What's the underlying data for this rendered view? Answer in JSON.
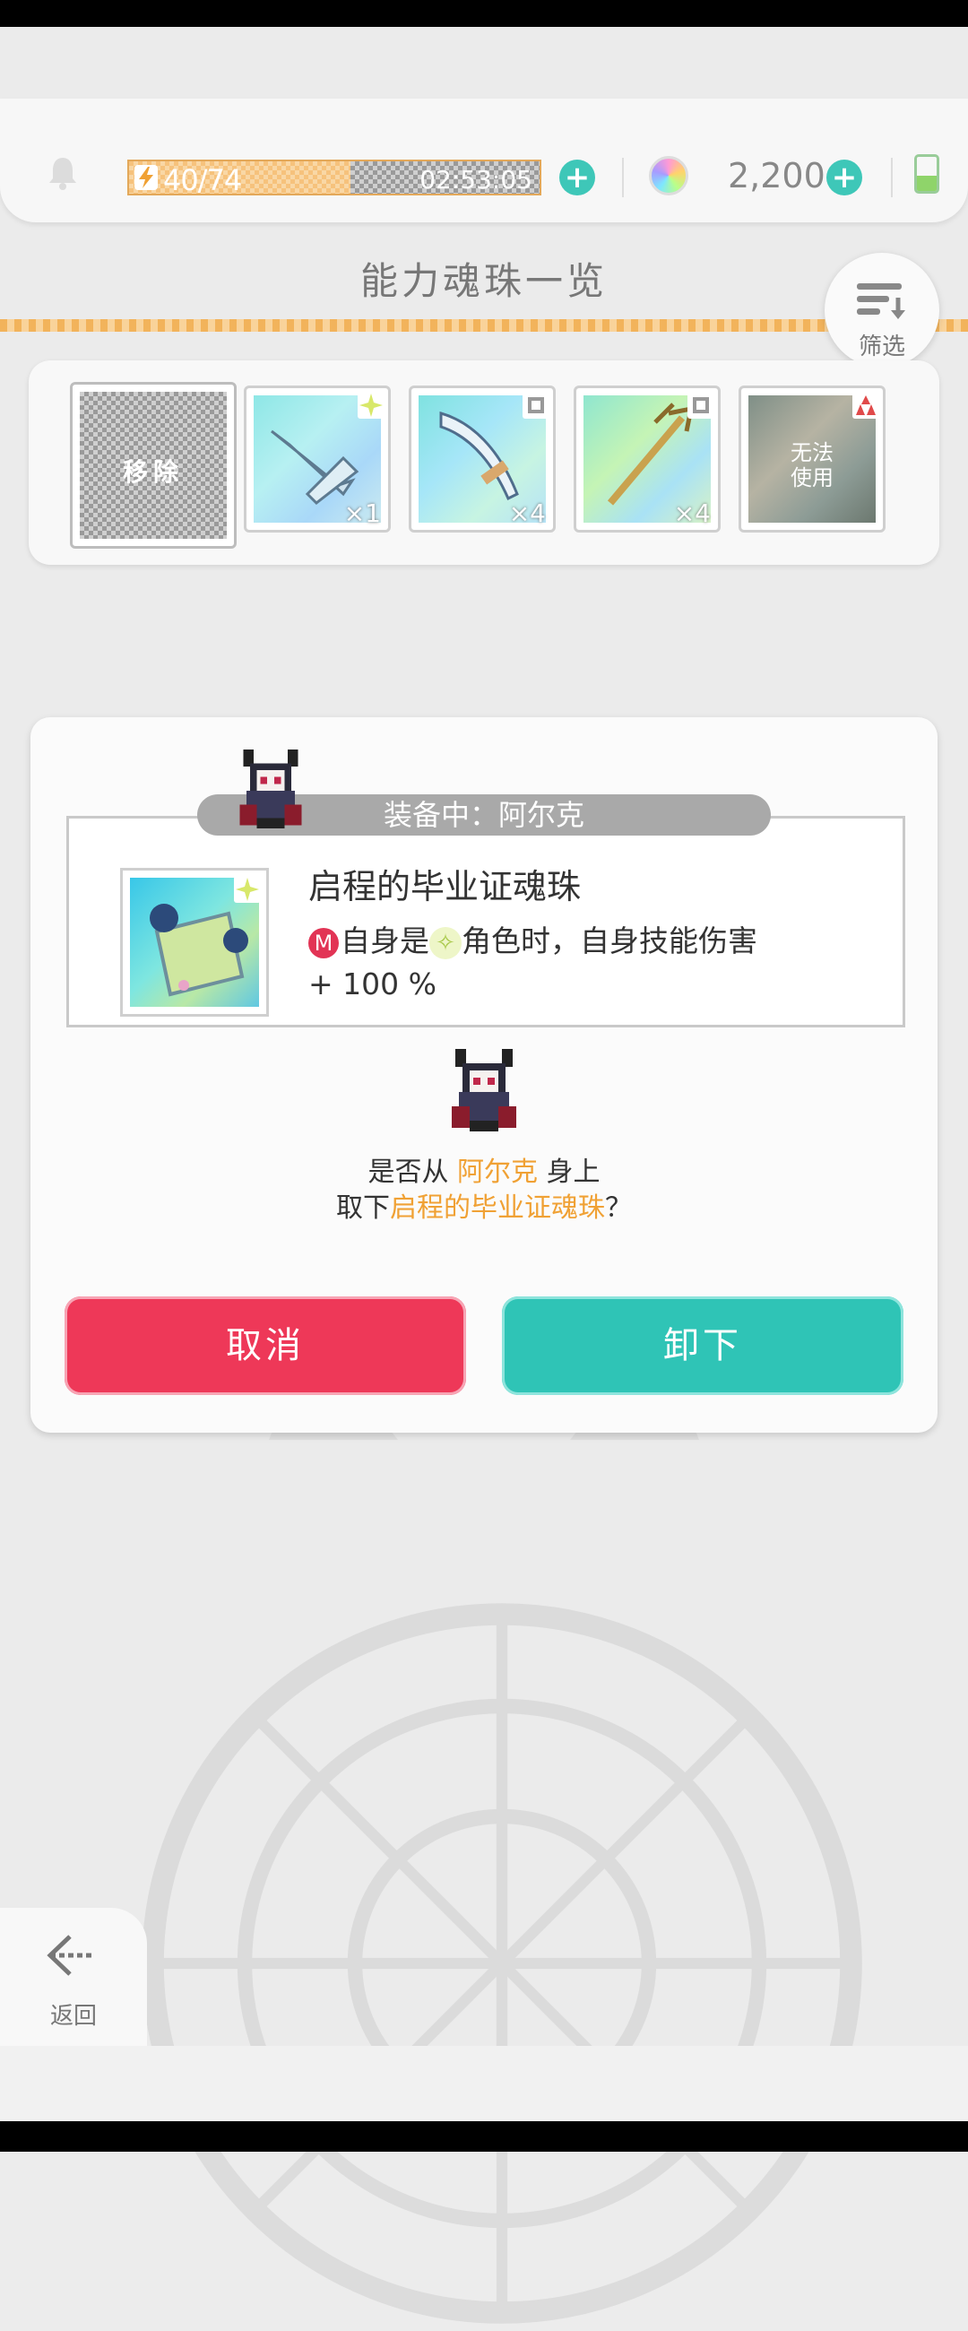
{
  "status_bar": {
    "stamina_text": "40/74",
    "stamina_fraction": 0.54,
    "timer": "02:53:05",
    "gem_count": "2,200",
    "battery_fraction": 0.45
  },
  "header": {
    "title": "能力魂珠一览",
    "filter_label": "筛选"
  },
  "shelf": {
    "remove_label": "移除",
    "slots": [
      {
        "count": "×1"
      },
      {
        "count": "×4"
      },
      {
        "count": "×4"
      },
      {
        "unusable_line1": "无法",
        "unusable_line2": "使用"
      }
    ]
  },
  "dialog": {
    "equip_banner": "装备中：阿尔克",
    "gem_name": "启程的毕业证魂珠",
    "desc_part1": "自身是",
    "desc_part2": "角色时，自身技能伤害",
    "desc_part3": "+ 100 %",
    "m_badge": "M",
    "question_part1": "是否从 ",
    "question_character": "阿尔克",
    "question_part2": " 身上",
    "question_part3": "取下",
    "question_gem": "启程的毕业证魂珠",
    "question_part4": "？",
    "cancel_label": "取消",
    "confirm_label": "卸下"
  },
  "nav": {
    "back_label": "返回"
  },
  "colors": {
    "accent_teal": "#2fc4b6",
    "cancel_red": "#ee3858",
    "highlight_orange": "#f0a134",
    "stamina_orange": "#f6c27c"
  }
}
